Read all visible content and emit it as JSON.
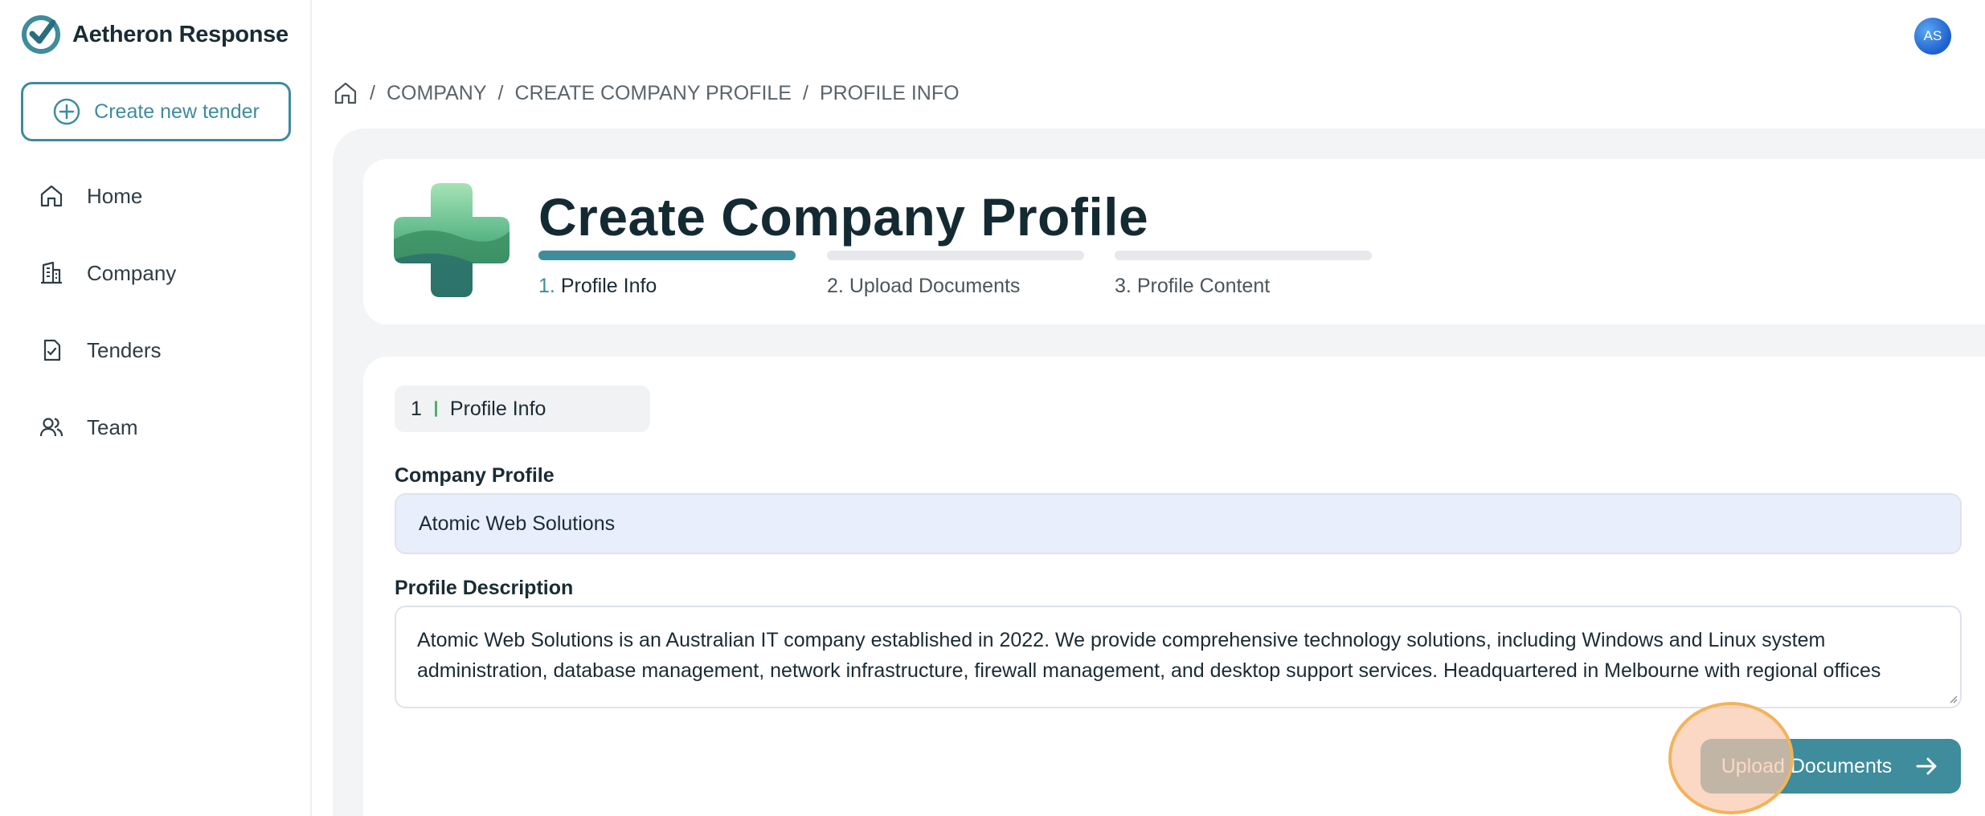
{
  "app": {
    "name": "Aetheron Response",
    "accent": "#3e8c9c"
  },
  "sidebar": {
    "create_label": "Create new tender",
    "items": [
      {
        "label": "Home",
        "icon": "home-icon"
      },
      {
        "label": "Company",
        "icon": "building-icon"
      },
      {
        "label": "Tenders",
        "icon": "document-check-icon"
      },
      {
        "label": "Team",
        "icon": "users-icon"
      }
    ]
  },
  "user": {
    "initials": "AS"
  },
  "breadcrumb": [
    "COMPANY",
    "CREATE COMPANY PROFILE",
    "PROFILE INFO"
  ],
  "page": {
    "title": "Create Company Profile",
    "steps": [
      {
        "num": "1.",
        "label": "Profile Info",
        "active": true
      },
      {
        "num": "2.",
        "label": "Upload Documents",
        "active": false
      },
      {
        "num": "3.",
        "label": "Profile Content",
        "active": false
      }
    ]
  },
  "form": {
    "section_num": "1",
    "section_label": "Profile Info",
    "company_profile_label": "Company Profile",
    "company_profile_value": "Atomic Web Solutions",
    "description_label": "Profile Description",
    "description_value": "Atomic Web Solutions is an Australian IT company established in 2022. We provide comprehensive technology solutions, including Windows and Linux system administration, database management, network infrastructure, firewall management, and desktop support services. Headquartered in Melbourne with regional offices",
    "next_label": "Upload Documents"
  }
}
